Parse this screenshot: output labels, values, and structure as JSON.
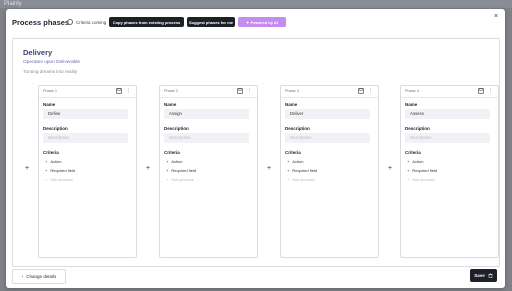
{
  "app": {
    "logo_text": "Plainly"
  },
  "modal": {
    "title": "Process phases",
    "criteria_toggle_label": "Criteria coming",
    "copy_button": "Copy phases from existing process",
    "suggest_button": "Suggest phases for me",
    "ai_badge": "✦ Powered by AI",
    "close_label": "×"
  },
  "process": {
    "title": "Delivery",
    "subtitle": "Operates upon Deliverable",
    "description": "Turning dreams into reality"
  },
  "labels": {
    "name": "Name",
    "description": "Description",
    "criteria": "Criteria",
    "description_placeholder": "Description",
    "action": "Action",
    "required_field": "Required field",
    "sub_process": "Sub-process",
    "add_plus": "+"
  },
  "phases": [
    {
      "phase_label": "Phase 1",
      "name": "Define"
    },
    {
      "phase_label": "Phase 2",
      "name": "Assign"
    },
    {
      "phase_label": "Phase 3",
      "name": "Deliver"
    },
    {
      "phase_label": "Phase 4",
      "name": "Assess"
    }
  ],
  "footer": {
    "change_details_button": "Change details",
    "save_button": "Save"
  }
}
